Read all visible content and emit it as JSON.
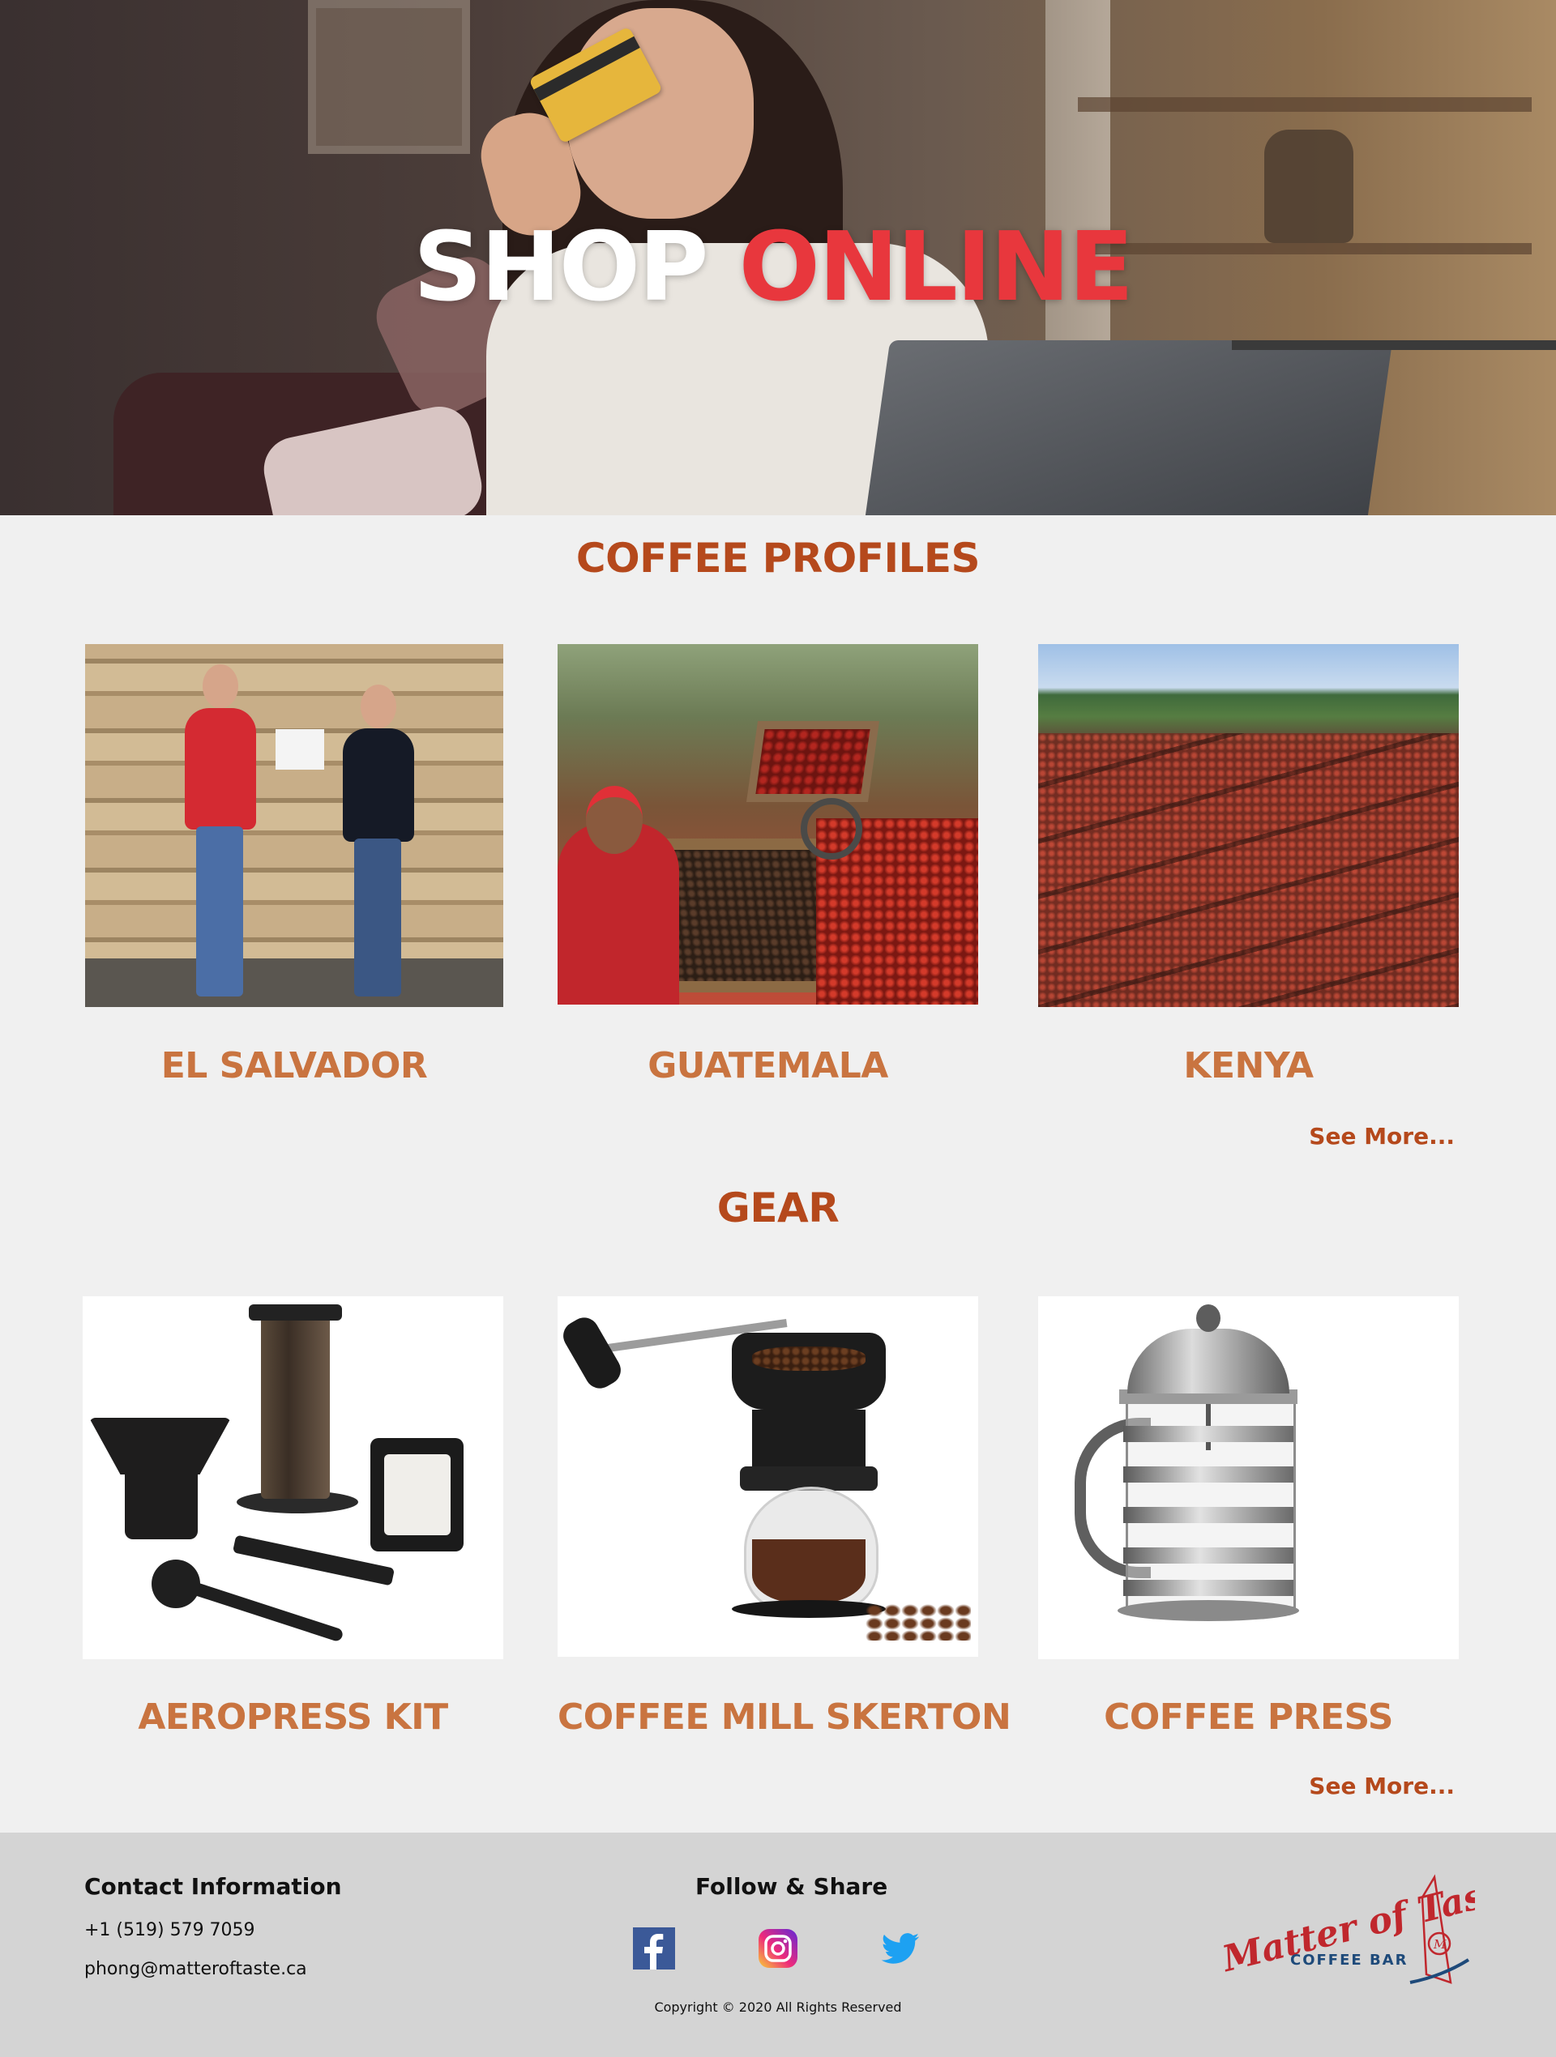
{
  "hero": {
    "title_part1": "SHOP",
    "title_part2": "ONLINE"
  },
  "coffee_profiles": {
    "heading": "COFFEE PROFILES",
    "items": [
      {
        "label": "EL SALVADOR"
      },
      {
        "label": "GUATEMALA"
      },
      {
        "label": "KENYA"
      }
    ],
    "see_more": "See More..."
  },
  "gear": {
    "heading": "GEAR",
    "items": [
      {
        "label": "AEROPRESS KIT"
      },
      {
        "label": "COFFEE MILL SKERTON"
      },
      {
        "label": "COFFEE PRESS"
      }
    ],
    "see_more": "See More..."
  },
  "footer": {
    "contact_heading": "Contact Information",
    "phone": "+1 (519) 579 7059",
    "email": "phong@matteroftaste.ca",
    "follow_heading": "Follow & Share",
    "social": [
      {
        "icon": "facebook-icon"
      },
      {
        "icon": "instagram-icon"
      },
      {
        "icon": "twitter-icon"
      }
    ],
    "copyright": "Copyright © 2020 All Rights Reserved",
    "logo": {
      "script": "Matter of Taste",
      "subtitle": "COFFEE BAR"
    }
  },
  "colors": {
    "accent_red": "#e8373d",
    "heading_rust": "#b5491c",
    "caption_orange": "#c97440",
    "page_bg": "#f0f0f0",
    "footer_bg": "#d4d4d4"
  }
}
